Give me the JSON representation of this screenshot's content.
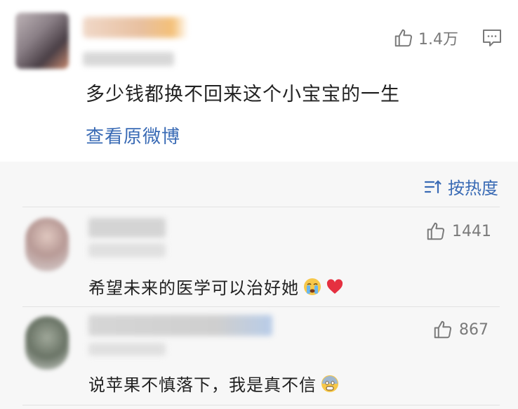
{
  "main_comment": {
    "likes": "1.4万",
    "text": "多少钱都换不回来这个小宝宝的一生",
    "view_original": "查看原微博"
  },
  "sort": {
    "label": "按热度"
  },
  "replies": [
    {
      "likes": "1441",
      "text": "希望未来的医学可以治好她"
    },
    {
      "likes": "867",
      "text": "说苹果不慎落下，我是真不信"
    }
  ],
  "icons": {
    "like": "thumbs-up-icon",
    "comment": "comment-icon",
    "sort": "sort-icon",
    "crying": "crying-face-emoji-icon",
    "heart": "red-heart-emoji-icon",
    "fearful": "fearful-face-emoji-icon"
  },
  "colors": {
    "link": "#3a6bb5",
    "meta": "#7a7a7a",
    "reply_bg": "#f7f7f7"
  }
}
